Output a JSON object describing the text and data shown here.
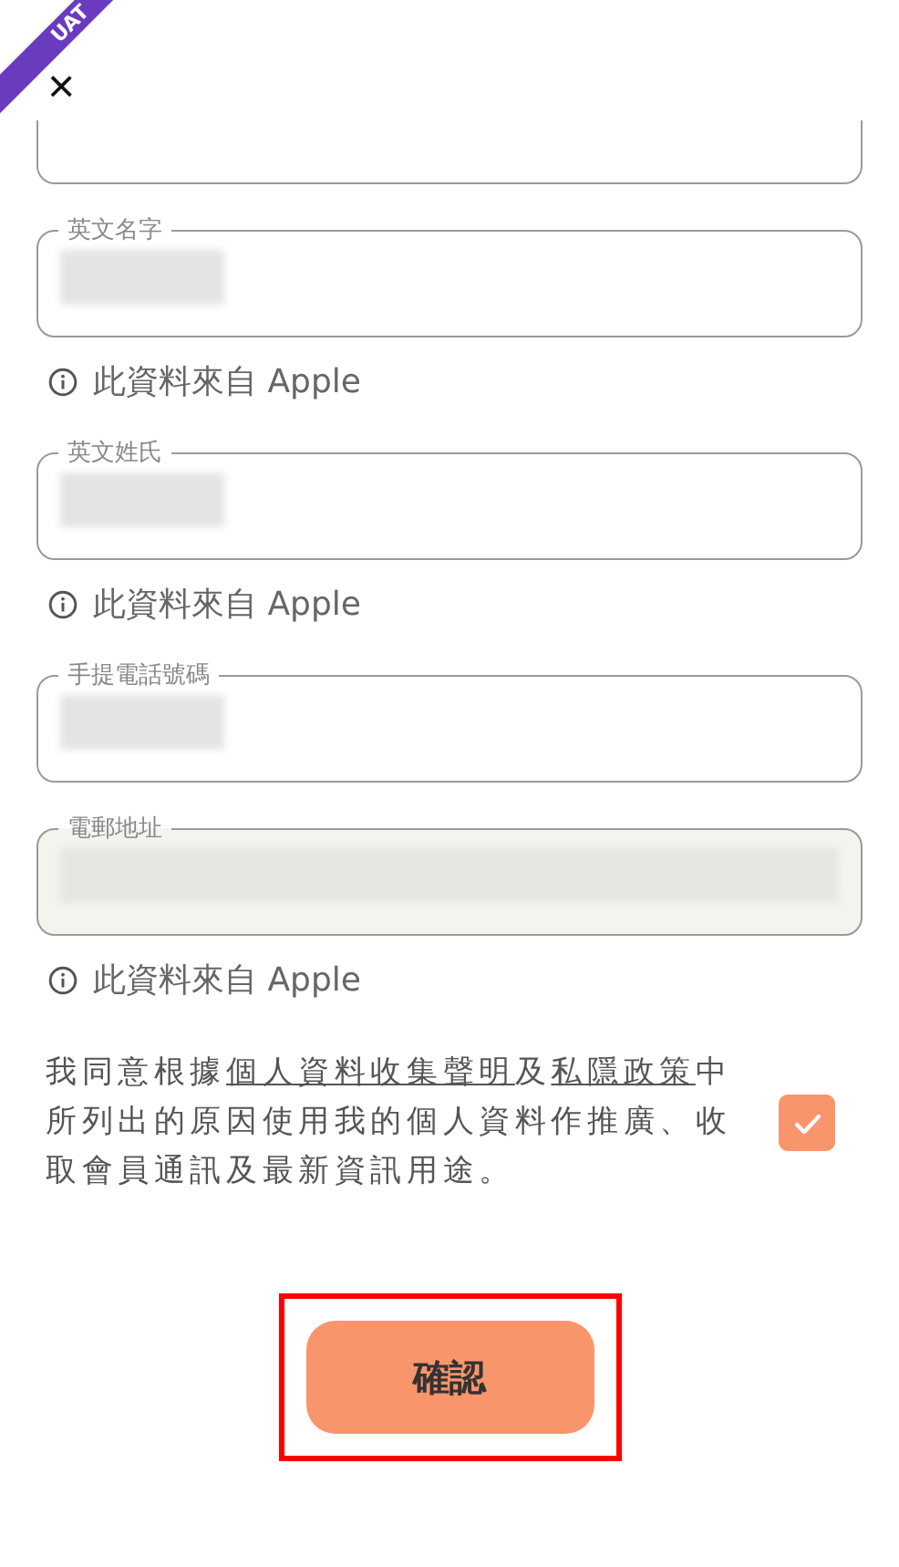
{
  "banner": {
    "text": "UAT"
  },
  "close": {
    "text": "×"
  },
  "fields": [
    {
      "kind": "partial"
    },
    {
      "kind": "text",
      "label": "英文名字",
      "redacted": true,
      "disabled": false,
      "note": "此資料來自 Apple"
    },
    {
      "kind": "text",
      "label": "英文姓氏",
      "redacted": true,
      "disabled": false,
      "note": "此資料來自 Apple"
    },
    {
      "kind": "text",
      "label": "手提電話號碼",
      "redacted": true,
      "disabled": false
    },
    {
      "kind": "text",
      "label": "電郵地址",
      "redacted": true,
      "disabled": true,
      "note": "此資料來自 Apple"
    }
  ],
  "consent": {
    "checked": true,
    "parts": [
      {
        "text": "我同意根據",
        "link": false
      },
      {
        "text": "個人資料收集聲明",
        "link": true
      },
      {
        "text": "及",
        "link": false
      },
      {
        "text": "私隱政策",
        "link": true
      },
      {
        "text": "中所列出的原因使用我的個人資料作推廣、收取會員通訊及最新資訊用途。",
        "link": false
      }
    ]
  },
  "confirm": {
    "label": "確認",
    "highlighted": true
  }
}
